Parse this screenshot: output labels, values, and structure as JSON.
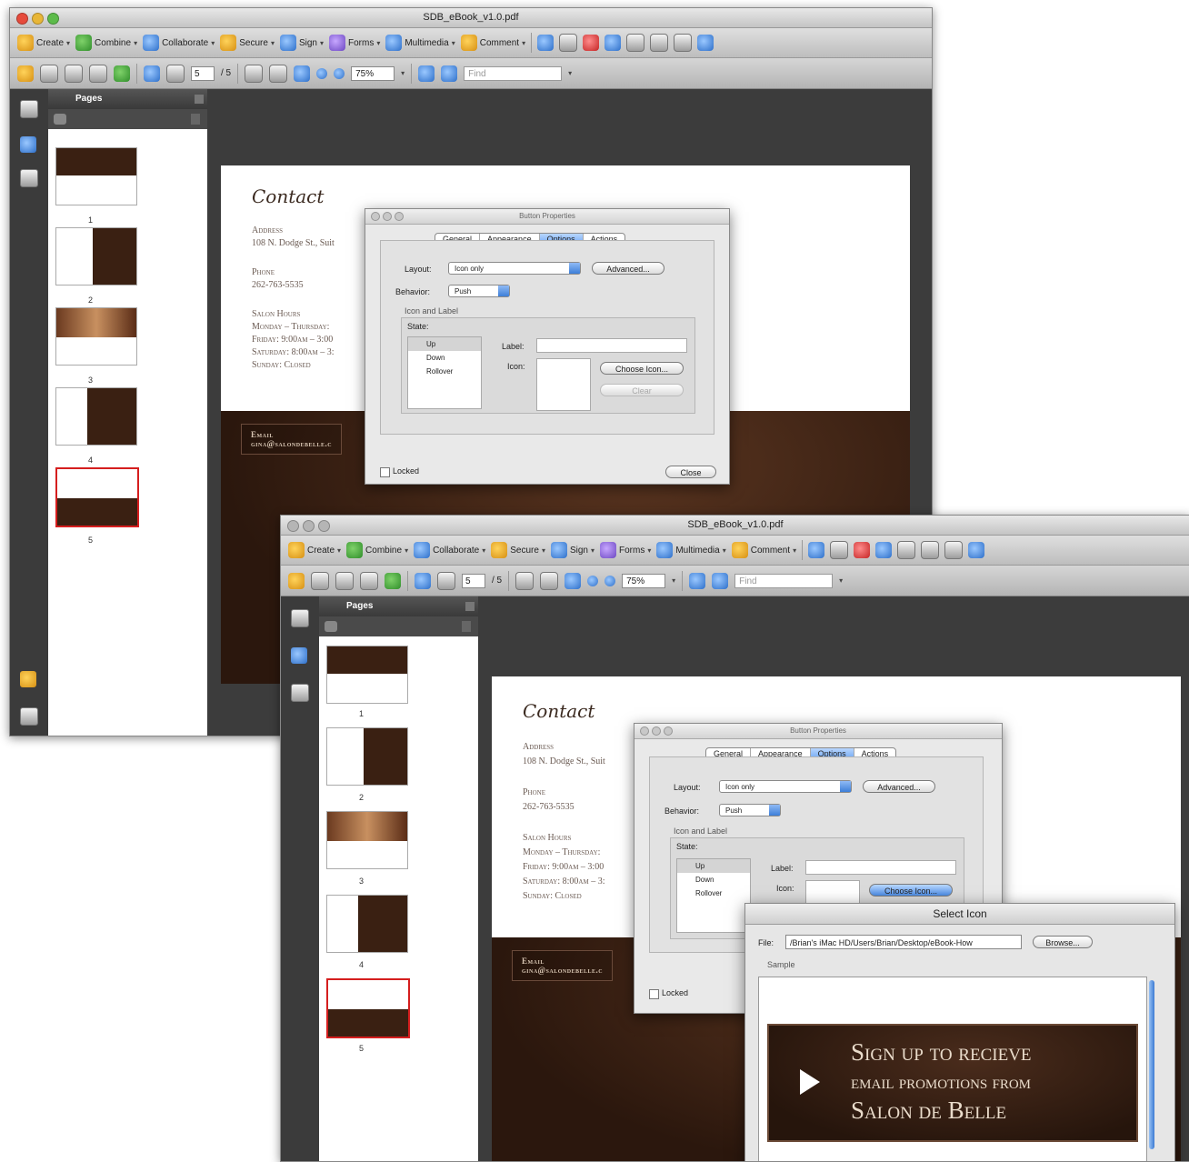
{
  "window1": {
    "title": "SDB_eBook_v1.0.pdf",
    "toolbar": [
      "Create",
      "Combine",
      "Collaborate",
      "Secure",
      "Sign",
      "Forms",
      "Multimedia",
      "Comment"
    ],
    "page_current": "5",
    "page_total": "/ 5",
    "zoom": "75%",
    "find_placeholder": "Find",
    "pages_panel_title": "Pages",
    "thumb_numbers": [
      "1",
      "2",
      "3",
      "4",
      "5"
    ]
  },
  "window2": {
    "title": "SDB_eBook_v1.0.pdf",
    "toolbar": [
      "Create",
      "Combine",
      "Collaborate",
      "Secure",
      "Sign",
      "Forms",
      "Multimedia",
      "Comment"
    ],
    "page_current": "5",
    "page_total": "/ 5",
    "zoom": "75%",
    "find_placeholder": "Find",
    "pages_panel_title": "Pages",
    "thumb_numbers": [
      "1",
      "2",
      "3",
      "4",
      "5"
    ]
  },
  "document": {
    "heading": "Contact",
    "address_label": "Address",
    "address_value": "108 N. Dodge St., Suit",
    "phone_label": "Phone",
    "phone_value": "262-763-5535",
    "hours_label": "Salon Hours",
    "hours_lines": [
      "Monday – Thursday:",
      "Friday: 9:00am – 3:00",
      "Saturday: 8:00am – 3:",
      "Sunday: Closed"
    ],
    "email_label": "Email",
    "email_value": "gina@salondebelle.c"
  },
  "button_properties": {
    "title": "Button Properties",
    "tabs": [
      "General",
      "Appearance",
      "Options",
      "Actions"
    ],
    "active_tab": "Options",
    "layout_label": "Layout:",
    "layout_value": "Icon only",
    "advanced_button": "Advanced...",
    "behavior_label": "Behavior:",
    "behavior_value": "Push",
    "icon_label_section": "Icon and Label",
    "state_label": "State:",
    "states": [
      "Up",
      "Down",
      "Rollover"
    ],
    "selected_state": "Up",
    "label_field_label": "Label:",
    "icon_field_label": "Icon:",
    "choose_icon_button": "Choose Icon...",
    "clear_button": "Clear",
    "locked_label": "Locked",
    "close_button": "Close"
  },
  "select_icon": {
    "title": "Select Icon",
    "file_label": "File:",
    "file_path": "/Brian's iMac HD/Users/Brian/Desktop/eBook-How",
    "browse_button": "Browse...",
    "sample_label": "Sample",
    "promo_lines": [
      "Sign up to recieve",
      "email promotions from",
      "Salon de Belle"
    ]
  },
  "colors": {
    "accent_blue": "#4b8ae2",
    "selected_thumb_border": "#d51e1e",
    "document_brown": "#2b170d",
    "text_brown": "#3b2a20"
  }
}
